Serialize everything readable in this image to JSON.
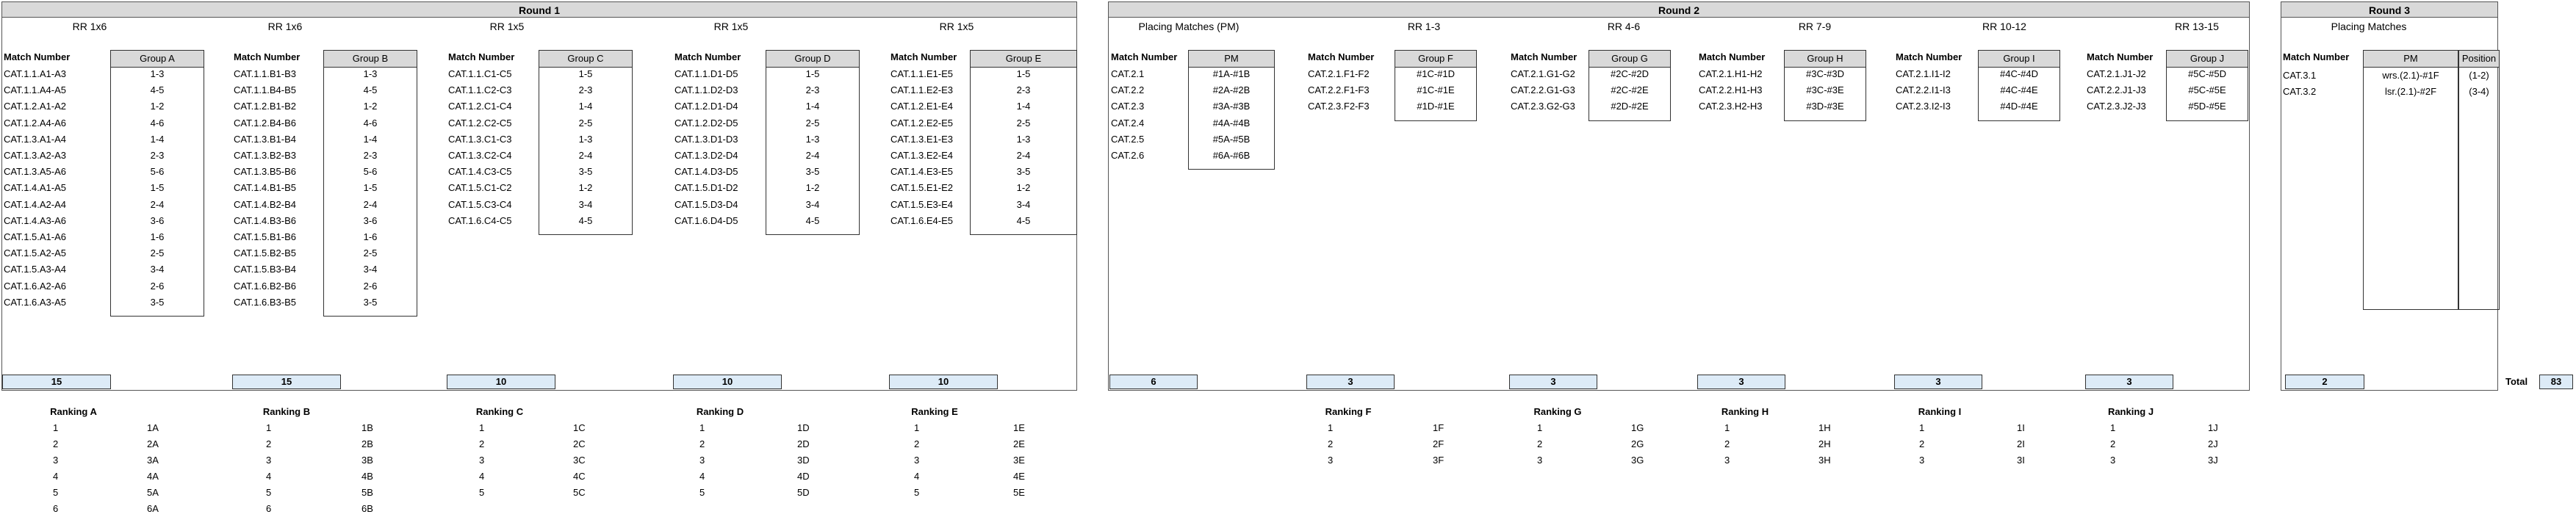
{
  "round1": {
    "title": "Round 1",
    "groups": [
      {
        "key": "A",
        "subtitle": "RR 1x6",
        "match_header": "Match Number",
        "group_header": "Group A",
        "matches": [
          "CAT.1.1.A1-A3",
          "CAT.1.1.A4-A5",
          "CAT.1.2.A1-A2",
          "CAT.1.2.A4-A6",
          "CAT.1.3.A1-A4",
          "CAT.1.3.A2-A3",
          "CAT.1.3.A5-A6",
          "CAT.1.4.A1-A5",
          "CAT.1.4.A2-A4",
          "CAT.1.4.A3-A6",
          "CAT.1.5.A1-A6",
          "CAT.1.5.A2-A5",
          "CAT.1.5.A3-A4",
          "CAT.1.6.A2-A6",
          "CAT.1.6.A3-A5"
        ],
        "pairs": [
          "1-3",
          "4-5",
          "1-2",
          "4-6",
          "1-4",
          "2-3",
          "5-6",
          "1-5",
          "2-4",
          "3-6",
          "1-6",
          "2-5",
          "3-4",
          "2-6",
          "3-5"
        ],
        "total": "15",
        "ranking_title": "Ranking A",
        "ranking": [
          [
            "1",
            "1A"
          ],
          [
            "2",
            "2A"
          ],
          [
            "3",
            "3A"
          ],
          [
            "4",
            "4A"
          ],
          [
            "5",
            "5A"
          ],
          [
            "6",
            "6A"
          ]
        ]
      },
      {
        "key": "B",
        "subtitle": "RR 1x6",
        "match_header": "Match Number",
        "group_header": "Group B",
        "matches": [
          "CAT.1.1.B1-B3",
          "CAT.1.1.B4-B5",
          "CAT.1.2.B1-B2",
          "CAT.1.2.B4-B6",
          "CAT.1.3.B1-B4",
          "CAT.1.3.B2-B3",
          "CAT.1.3.B5-B6",
          "CAT.1.4.B1-B5",
          "CAT.1.4.B2-B4",
          "CAT.1.4.B3-B6",
          "CAT.1.5.B1-B6",
          "CAT.1.5.B2-B5",
          "CAT.1.5.B3-B4",
          "CAT.1.6.B2-B6",
          "CAT.1.6.B3-B5"
        ],
        "pairs": [
          "1-3",
          "4-5",
          "1-2",
          "4-6",
          "1-4",
          "2-3",
          "5-6",
          "1-5",
          "2-4",
          "3-6",
          "1-6",
          "2-5",
          "3-4",
          "2-6",
          "3-5"
        ],
        "total": "15",
        "ranking_title": "Ranking B",
        "ranking": [
          [
            "1",
            "1B"
          ],
          [
            "2",
            "2B"
          ],
          [
            "3",
            "3B"
          ],
          [
            "4",
            "4B"
          ],
          [
            "5",
            "5B"
          ],
          [
            "6",
            "6B"
          ]
        ]
      },
      {
        "key": "C",
        "subtitle": "RR 1x5",
        "match_header": "Match Number",
        "group_header": "Group C",
        "matches": [
          "CAT.1.1.C1-C5",
          "CAT.1.1.C2-C3",
          "CAT.1.2.C1-C4",
          "CAT.1.2.C2-C5",
          "CAT.1.3.C1-C3",
          "CAT.1.3.C2-C4",
          "CAT.1.4.C3-C5",
          "CAT.1.5.C1-C2",
          "CAT.1.5.C3-C4",
          "CAT.1.6.C4-C5"
        ],
        "pairs": [
          "1-5",
          "2-3",
          "1-4",
          "2-5",
          "1-3",
          "2-4",
          "3-5",
          "1-2",
          "3-4",
          "4-5"
        ],
        "total": "10",
        "ranking_title": "Ranking C",
        "ranking": [
          [
            "1",
            "1C"
          ],
          [
            "2",
            "2C"
          ],
          [
            "3",
            "3C"
          ],
          [
            "4",
            "4C"
          ],
          [
            "5",
            "5C"
          ]
        ]
      },
      {
        "key": "D",
        "subtitle": "RR 1x5",
        "match_header": "Match Number",
        "group_header": "Group D",
        "matches": [
          "CAT.1.1.D1-D5",
          "CAT.1.1.D2-D3",
          "CAT.1.2.D1-D4",
          "CAT.1.2.D2-D5",
          "CAT.1.3.D1-D3",
          "CAT.1.3.D2-D4",
          "CAT.1.4.D3-D5",
          "CAT.1.5.D1-D2",
          "CAT.1.5.D3-D4",
          "CAT.1.6.D4-D5"
        ],
        "pairs": [
          "1-5",
          "2-3",
          "1-4",
          "2-5",
          "1-3",
          "2-4",
          "3-5",
          "1-2",
          "3-4",
          "4-5"
        ],
        "total": "10",
        "ranking_title": "Ranking D",
        "ranking": [
          [
            "1",
            "1D"
          ],
          [
            "2",
            "2D"
          ],
          [
            "3",
            "3D"
          ],
          [
            "4",
            "4D"
          ],
          [
            "5",
            "5D"
          ]
        ]
      },
      {
        "key": "E",
        "subtitle": "RR 1x5",
        "match_header": "Match Number",
        "group_header": "Group E",
        "matches": [
          "CAT.1.1.E1-E5",
          "CAT.1.1.E2-E3",
          "CAT.1.2.E1-E4",
          "CAT.1.2.E2-E5",
          "CAT.1.3.E1-E3",
          "CAT.1.3.E2-E4",
          "CAT.1.4.E3-E5",
          "CAT.1.5.E1-E2",
          "CAT.1.5.E3-E4",
          "CAT.1.6.E4-E5"
        ],
        "pairs": [
          "1-5",
          "2-3",
          "1-4",
          "2-5",
          "1-3",
          "2-4",
          "3-5",
          "1-2",
          "3-4",
          "4-5"
        ],
        "total": "10",
        "ranking_title": "Ranking E",
        "ranking": [
          [
            "1",
            "1E"
          ],
          [
            "2",
            "2E"
          ],
          [
            "3",
            "3E"
          ],
          [
            "4",
            "4E"
          ],
          [
            "5",
            "5E"
          ]
        ]
      }
    ]
  },
  "round2": {
    "title": "Round 2",
    "groups": [
      {
        "key": "PM",
        "subtitle": "Placing Matches (PM)",
        "match_header": "Match Number",
        "group_header": "PM",
        "matches": [
          "CAT.2.1",
          "CAT.2.2",
          "CAT.2.3",
          "CAT.2.4",
          "CAT.2.5",
          "CAT.2.6"
        ],
        "pairs": [
          "#1A-#1B",
          "#2A-#2B",
          "#3A-#3B",
          "#4A-#4B",
          "#5A-#5B",
          "#6A-#6B"
        ],
        "total": "6",
        "ranking_title": "",
        "ranking": []
      },
      {
        "key": "F",
        "subtitle": "RR 1-3",
        "match_header": "Match Number",
        "group_header": "Group F",
        "matches": [
          "CAT.2.1.F1-F2",
          "CAT.2.2.F1-F3",
          "CAT.2.3.F2-F3"
        ],
        "pairs": [
          "#1C-#1D",
          "#1C-#1E",
          "#1D-#1E"
        ],
        "total": "3",
        "ranking_title": "Ranking F",
        "ranking": [
          [
            "1",
            "1F"
          ],
          [
            "2",
            "2F"
          ],
          [
            "3",
            "3F"
          ]
        ]
      },
      {
        "key": "G",
        "subtitle": "RR 4-6",
        "match_header": "Match Number",
        "group_header": "Group G",
        "matches": [
          "CAT.2.1.G1-G2",
          "CAT.2.2.G1-G3",
          "CAT.2.3.G2-G3"
        ],
        "pairs": [
          "#2C-#2D",
          "#2C-#2E",
          "#2D-#2E"
        ],
        "total": "3",
        "ranking_title": "Ranking G",
        "ranking": [
          [
            "1",
            "1G"
          ],
          [
            "2",
            "2G"
          ],
          [
            "3",
            "3G"
          ]
        ]
      },
      {
        "key": "H",
        "subtitle": "RR 7-9",
        "match_header": "Match Number",
        "group_header": "Group H",
        "matches": [
          "CAT.2.1.H1-H2",
          "CAT.2.2.H1-H3",
          "CAT.2.3.H2-H3"
        ],
        "pairs": [
          "#3C-#3D",
          "#3C-#3E",
          "#3D-#3E"
        ],
        "total": "3",
        "ranking_title": "Ranking H",
        "ranking": [
          [
            "1",
            "1H"
          ],
          [
            "2",
            "2H"
          ],
          [
            "3",
            "3H"
          ]
        ]
      },
      {
        "key": "I",
        "subtitle": "RR 10-12",
        "match_header": "Match Number",
        "group_header": "Group I",
        "matches": [
          "CAT.2.1.I1-I2",
          "CAT.2.2.I1-I3",
          "CAT.2.3.I2-I3"
        ],
        "pairs": [
          "#4C-#4D",
          "#4C-#4E",
          "#4D-#4E"
        ],
        "total": "3",
        "ranking_title": "Ranking I",
        "ranking": [
          [
            "1",
            "1I"
          ],
          [
            "2",
            "2I"
          ],
          [
            "3",
            "3I"
          ]
        ]
      },
      {
        "key": "J",
        "subtitle": "RR 13-15",
        "match_header": "Match Number",
        "group_header": "Group J",
        "matches": [
          "CAT.2.1.J1-J2",
          "CAT.2.2.J1-J3",
          "CAT.2.3.J2-J3"
        ],
        "pairs": [
          "#5C-#5D",
          "#5C-#5E",
          "#5D-#5E"
        ],
        "total": "3",
        "ranking_title": "Ranking J",
        "ranking": [
          [
            "1",
            "1J"
          ],
          [
            "2",
            "2J"
          ],
          [
            "3",
            "3J"
          ]
        ]
      }
    ]
  },
  "round3": {
    "title": "Round 3",
    "subtitle": "Placing Matches",
    "match_header": "Match Number",
    "pm_header": "PM",
    "position_header": "Position",
    "rows": [
      {
        "match": "CAT.3.1",
        "pm": "wrs.(2.1)-#1F",
        "position": "(1-2)"
      },
      {
        "match": "CAT.3.2",
        "pm": "lsr.(2.1)-#2F",
        "position": "(3-4)"
      }
    ],
    "total": "2"
  },
  "grand_total": {
    "label": "Total",
    "value": "83"
  }
}
